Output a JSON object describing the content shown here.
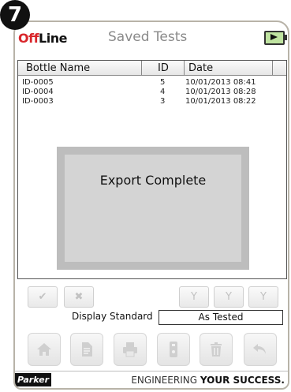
{
  "step_number": "7",
  "header": {
    "brand_off": "Off",
    "brand_line": "Line",
    "title": "Saved Tests",
    "battery_icon": "battery-charging-icon"
  },
  "table": {
    "columns": [
      "Bottle Name",
      "ID",
      "Date"
    ],
    "rows": [
      {
        "name": "ID-0005",
        "id": "5",
        "date": "10/01/2013 08:41"
      },
      {
        "name": "ID-0004",
        "id": "4",
        "date": "10/01/2013 08:28"
      },
      {
        "name": "ID-0003",
        "id": "3",
        "date": "10/01/2013 08:22"
      }
    ]
  },
  "dialog": {
    "message": "Export Complete"
  },
  "selection_buttons": [
    {
      "icon": "check-all-icon",
      "glyph": "✔"
    },
    {
      "icon": "uncheck-all-icon",
      "glyph": "✖"
    },
    {
      "icon": "filter-icon",
      "glyph": "Y"
    },
    {
      "icon": "filter-remove-icon",
      "glyph": "Y"
    },
    {
      "icon": "filter-clear-icon",
      "glyph": "Y"
    }
  ],
  "display_standard": {
    "label": "Display Standard",
    "value": "As Tested"
  },
  "bottom_buttons": [
    {
      "icon": "home-icon"
    },
    {
      "icon": "document-icon"
    },
    {
      "icon": "printer-icon"
    },
    {
      "icon": "usb-drive-icon"
    },
    {
      "icon": "trash-icon"
    },
    {
      "icon": "back-icon"
    }
  ],
  "footer": {
    "logo_text": "Parker",
    "tagline_plain": "ENGINEERING ",
    "tagline_bold": "YOUR SUCCESS."
  },
  "colors": {
    "brand_red": "#d9262b",
    "frame": "#b8b3a8",
    "dialog_outer": "#bdbdbd",
    "dialog_inner": "#d4d4d4"
  }
}
